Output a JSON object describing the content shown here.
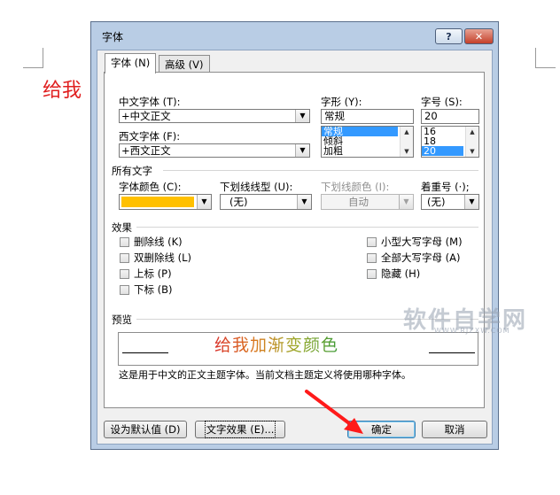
{
  "document": {
    "visible_text": "给我"
  },
  "dialog": {
    "title": "字体",
    "help_label": "?",
    "close_label": "✕",
    "tabs": [
      {
        "label": "字体 (N)",
        "active": true
      },
      {
        "label": "高级 (V)",
        "active": false
      }
    ],
    "font_section": {
      "chinese_font_label": "中文字体 (T):",
      "chinese_font_value": "+中文正文",
      "western_font_label": "西文字体 (F):",
      "western_font_value": "+西文正文",
      "style_label": "字形 (Y):",
      "style_value": "常规",
      "style_options": [
        "常规",
        "倾斜",
        "加粗"
      ],
      "style_selected": "常规",
      "size_label": "字号 (S):",
      "size_value": "20",
      "size_options": [
        "16",
        "18",
        "20"
      ],
      "size_selected": "20"
    },
    "all_text_section": {
      "heading": "所有文字",
      "font_color_label": "字体颜色 (C):",
      "font_color_value": "#ffc000",
      "underline_style_label": "下划线线型 (U):",
      "underline_style_value": "(无)",
      "underline_color_label": "下划线颜色 (I):",
      "underline_color_value": "自动",
      "emphasis_label": "着重号 (·);",
      "emphasis_value": "(无)"
    },
    "effects_section": {
      "heading": "效果",
      "left": [
        {
          "label": "删除线 (K)",
          "checked": false
        },
        {
          "label": "双删除线 (L)",
          "checked": false
        },
        {
          "label": "上标 (P)",
          "checked": false
        },
        {
          "label": "下标 (B)",
          "checked": false
        }
      ],
      "right": [
        {
          "label": "小型大写字母 (M)",
          "checked": false
        },
        {
          "label": "全部大写字母 (A)",
          "checked": false
        },
        {
          "label": "隐藏 (H)",
          "checked": false
        }
      ]
    },
    "preview_section": {
      "heading": "预览",
      "sample_text": "给我加渐变颜色",
      "description": "这是用于中文的正文主题字体。当前文档主题定义将使用哪种字体。"
    },
    "buttons": {
      "set_default": "设为默认值 (D)",
      "text_effects": "文字效果 (E)...",
      "ok": "确定",
      "cancel": "取消"
    }
  },
  "watermark": {
    "text": "软件自学网",
    "sub": "WWW.RJZXW.COM"
  }
}
